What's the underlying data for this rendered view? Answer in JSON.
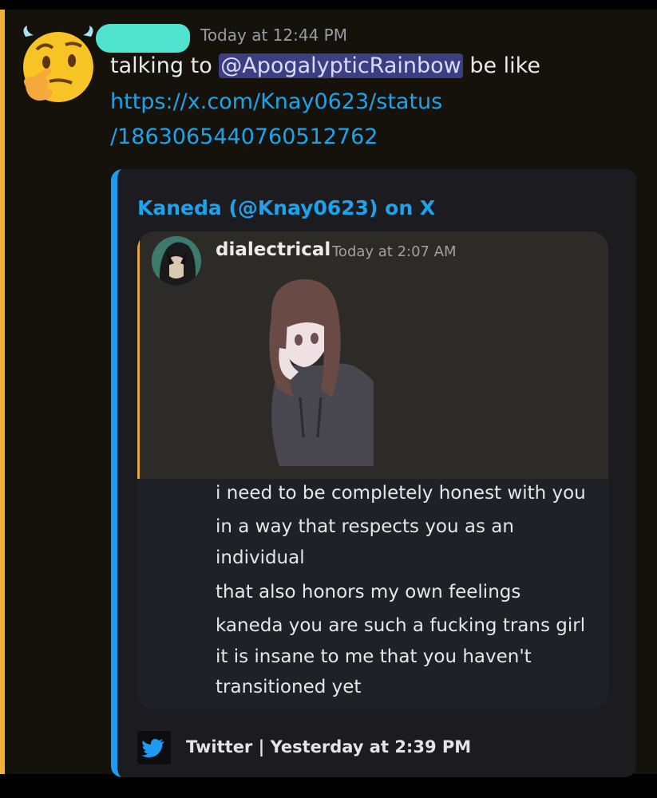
{
  "message": {
    "timestamp": "Today at 12:44 PM",
    "text_before_mention": "talking to ",
    "mention": "@ApogalypticRainbow",
    "text_after_mention": " be like",
    "link_line_1": "https://x.com/Knay0623/status",
    "link_line_2": "/1863065440760512762"
  },
  "embed": {
    "title": "Kaneda (@Knay0623) on X",
    "footer": "Twitter | Yesterday at 2:39 PM",
    "quoted_post": {
      "author": "dialectrical",
      "timestamp": "Today at 2:07 AM",
      "lines": [
        "i need to be completely honest with you",
        "in a way that respects you as an",
        "individual",
        "that also honors my own feelings",
        "kaneda you are such a fucking trans girl",
        "it is insane to me that you haven't",
        "transitioned yet"
      ]
    }
  },
  "icons": {
    "avatar": "thinking-face-emoji-with-horns",
    "footer": "twitter-bird-icon"
  },
  "colors": {
    "highlight": "#f0b232",
    "link": "#1ea2ea",
    "mention_bg": "#3b3f82",
    "embed_border": "#1d9bf0"
  }
}
